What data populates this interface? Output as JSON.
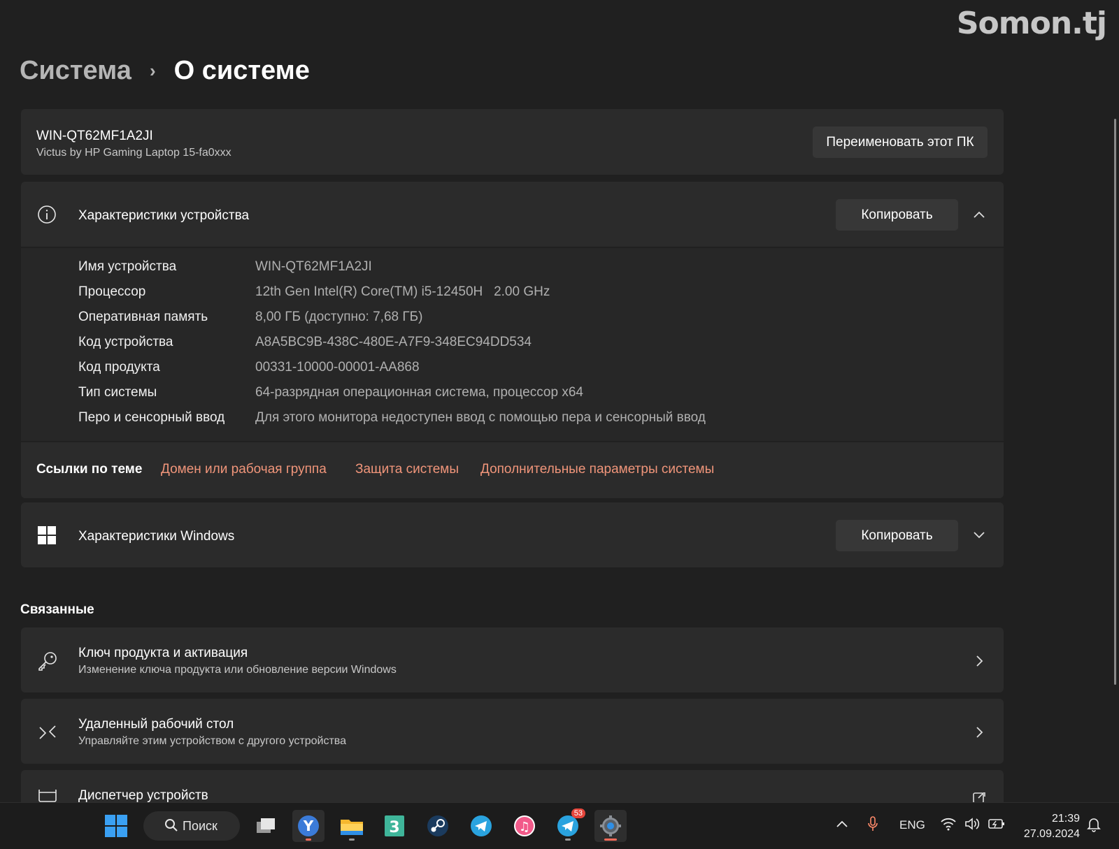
{
  "watermark": "Somon.tj",
  "breadcrumb": {
    "parent": "Система",
    "separator": "›",
    "current": "О системе"
  },
  "device": {
    "name": "WIN-QT62MF1A2JI",
    "model": "Victus by HP Gaming Laptop 15-fa0xxx",
    "rename_button": "Переименовать этот ПК"
  },
  "device_specs": {
    "title": "Характеристики устройства",
    "copy_button": "Копировать",
    "rows": [
      {
        "label": "Имя устройства",
        "value": "WIN-QT62MF1A2JI"
      },
      {
        "label": "Процессор",
        "value": "12th Gen Intel(R) Core(TM) i5-12450H   2.00 GHz"
      },
      {
        "label": "Оперативная память",
        "value": "8,00 ГБ (доступно: 7,68 ГБ)"
      },
      {
        "label": "Код устройства",
        "value": "A8A5BC9B-438C-480E-A7F9-348EC94DD534"
      },
      {
        "label": "Код продукта",
        "value": "00331-10000-00001-AA868"
      },
      {
        "label": "Тип системы",
        "value": "64-разрядная операционная система, процессор x64"
      },
      {
        "label": "Перо и сенсорный ввод",
        "value": "Для этого монитора недоступен ввод с помощью пера и сенсорный ввод"
      }
    ]
  },
  "related_links": {
    "label": "Ссылки по теме",
    "links": [
      "Домен или рабочая группа",
      "Защита системы",
      "Дополнительные параметры системы"
    ]
  },
  "windows_specs": {
    "title": "Характеристики Windows",
    "copy_button": "Копировать"
  },
  "related": {
    "title": "Связанные",
    "items": [
      {
        "title": "Ключ продукта и активация",
        "subtitle": "Изменение ключа продукта или обновление версии Windows"
      },
      {
        "title": "Удаленный рабочий стол",
        "subtitle": "Управляйте этим устройством с другого устройства"
      },
      {
        "title": "Диспетчер устройств"
      }
    ]
  },
  "taskbar": {
    "search_label": "Поиск",
    "telegram_badge": "53",
    "language": "ENG",
    "time": "21:39",
    "date": "27.09.2024"
  },
  "colors": {
    "accent_link": "#f0957a",
    "background": "#202020",
    "card": "#2b2b2b"
  }
}
